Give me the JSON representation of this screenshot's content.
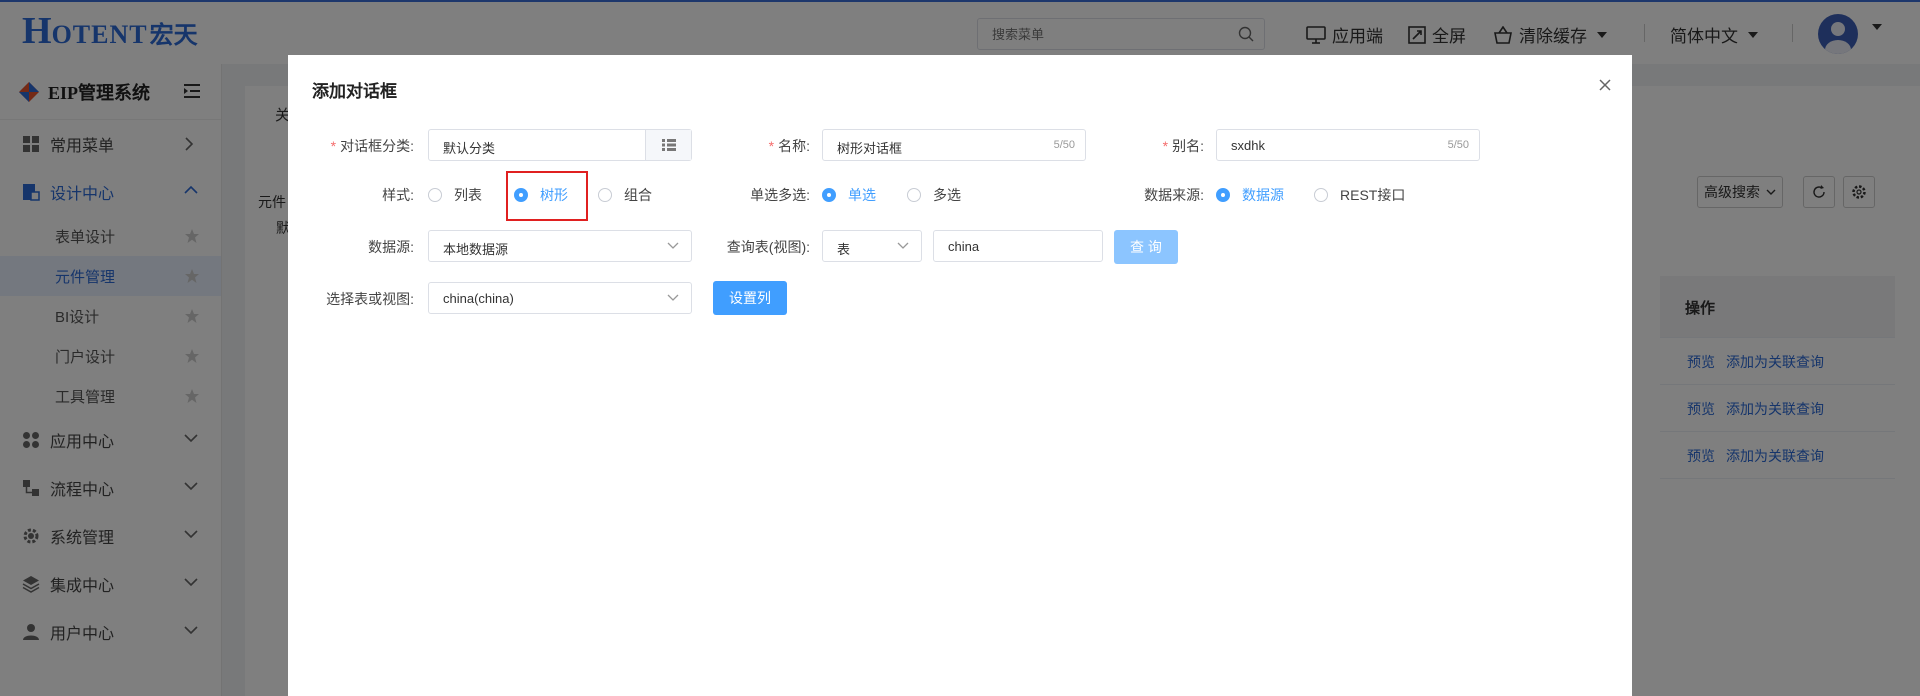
{
  "topbar": {
    "search_placeholder": "搜索菜单",
    "app_label": "应用端",
    "fullscreen_label": "全屏",
    "clear_cache_label": "清除缓存",
    "language_label": "简体中文"
  },
  "logo": {
    "h": "H",
    "rest": "OTENT",
    "cn": "宏天"
  },
  "sidebar": {
    "title": "EIP管理系统",
    "items": [
      {
        "label": "常用菜单"
      },
      {
        "label": "设计中心"
      },
      {
        "label": "应用中心"
      },
      {
        "label": "流程中心"
      },
      {
        "label": "系统管理"
      },
      {
        "label": "集成中心"
      },
      {
        "label": "用户中心"
      }
    ],
    "subitems": [
      {
        "label": "表单设计"
      },
      {
        "label": "元件管理"
      },
      {
        "label": "BI设计"
      },
      {
        "label": "门户设计"
      },
      {
        "label": "工具管理"
      }
    ]
  },
  "background": {
    "tab_partial": "关",
    "tree_item_1": "元件",
    "tree_item_2": "默",
    "advanced_search": "高级搜索",
    "table_header_ops": "操作",
    "row_link_preview": "预览",
    "row_link_add": "添加为关联查询"
  },
  "dialog": {
    "title": "添加对话框",
    "category_label": "对话框分类:",
    "category_value": "默认分类",
    "name_label": "名称:",
    "name_value": "树形对话框",
    "name_count": "5/50",
    "alias_label": "别名:",
    "alias_value": "sxdhk",
    "alias_count": "5/50",
    "style_label": "样式:",
    "style_options": [
      "列表",
      "树形",
      "组合"
    ],
    "select_mode_label": "单选多选:",
    "select_mode_options": [
      "单选",
      "多选"
    ],
    "data_source_type_label": "数据来源:",
    "data_source_type_options": [
      "数据源",
      "REST接口"
    ],
    "data_source_label": "数据源:",
    "data_source_value": "本地数据源",
    "query_table_label": "查询表(视图):",
    "query_table_type": "表",
    "query_table_input": "china",
    "query_button": "查 询",
    "select_table_label": "选择表或视图:",
    "select_table_value": "china(china)",
    "set_columns_button": "设置列"
  }
}
